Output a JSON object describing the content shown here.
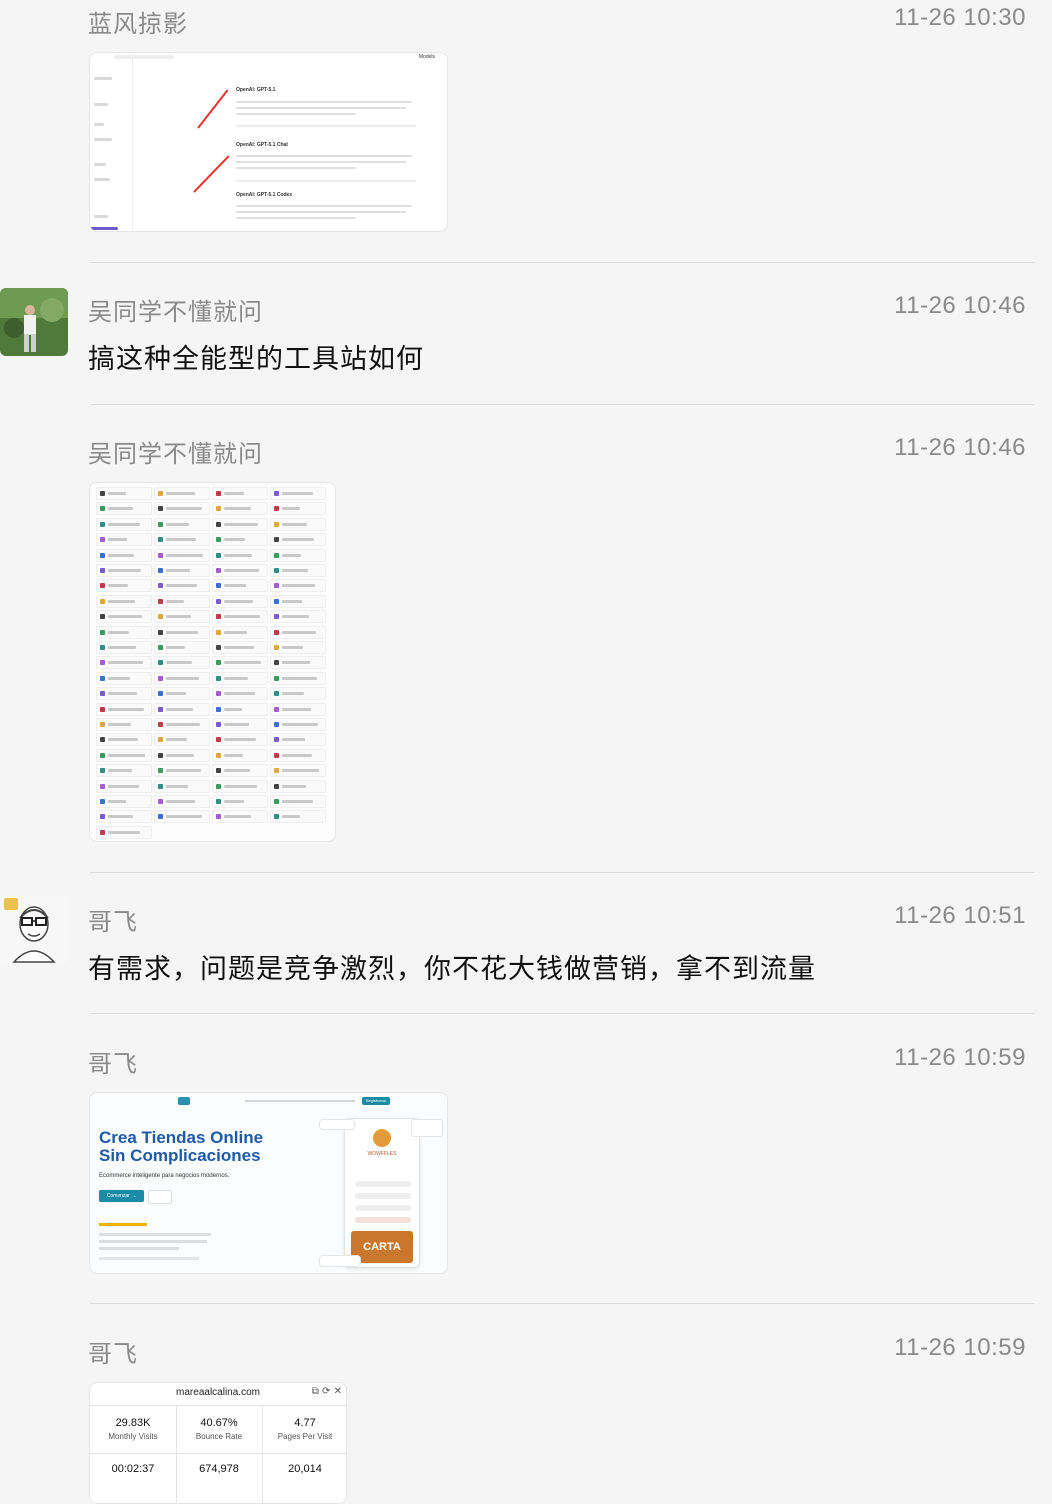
{
  "messages": [
    {
      "sender": "蓝风掠影",
      "time": "11-26 10:30",
      "type": "image"
    },
    {
      "sender": "吴同学不懂就问",
      "time": "11-26 10:46",
      "type": "text",
      "text": "搞这种全能型的工具站如何"
    },
    {
      "sender": "吴同学不懂就问",
      "time": "11-26 10:46",
      "type": "image"
    },
    {
      "sender": "哥飞",
      "time": "11-26 10:51",
      "type": "text",
      "text": "有需求，问题是竞争激烈，你不花大钱做营销，拿不到流量"
    },
    {
      "sender": "哥飞",
      "time": "11-26 10:59",
      "type": "image"
    },
    {
      "sender": "哥飞",
      "time": "11-26 10:59",
      "type": "image"
    }
  ],
  "thumb1": {
    "models": [
      "OpenAI: GPT-5.1",
      "OpenAI: GPT-5.1 Chat",
      "OpenAI: GPT-5.1 Codex"
    ],
    "top_right": "Models"
  },
  "thumb_ecommerce": {
    "headline_1": "Crea Tiendas Online",
    "headline_2": "Sin Complicaciones",
    "subtitle": "Ecommerce inteligente para negocios modernos.",
    "cta": "Comenzar →",
    "nav_button": "Registrarse",
    "phone_brand": "WOWFFLES",
    "phone_card": "CARTA"
  },
  "stats_card": {
    "domain": "mareaalcalina.com",
    "icons": "⧉ ⟳ ✕",
    "metrics": [
      {
        "value": "29.83K",
        "label": "Monthly Visits"
      },
      {
        "value": "40.67%",
        "label": "Bounce Rate"
      },
      {
        "value": "4.77",
        "label": "Pages Per Visit"
      },
      {
        "value": "00:02:37",
        "label": ""
      },
      {
        "value": "674,978",
        "label": ""
      },
      {
        "value": "20,014",
        "label": ""
      }
    ]
  },
  "colors": {
    "background": "#f5f5f5",
    "meta_text": "#8a8a8a",
    "divider": "#dcdcdc",
    "arrow_red": "#e8342c",
    "headline_blue": "#1d5ba8",
    "cta_teal": "#1a8ba4"
  }
}
